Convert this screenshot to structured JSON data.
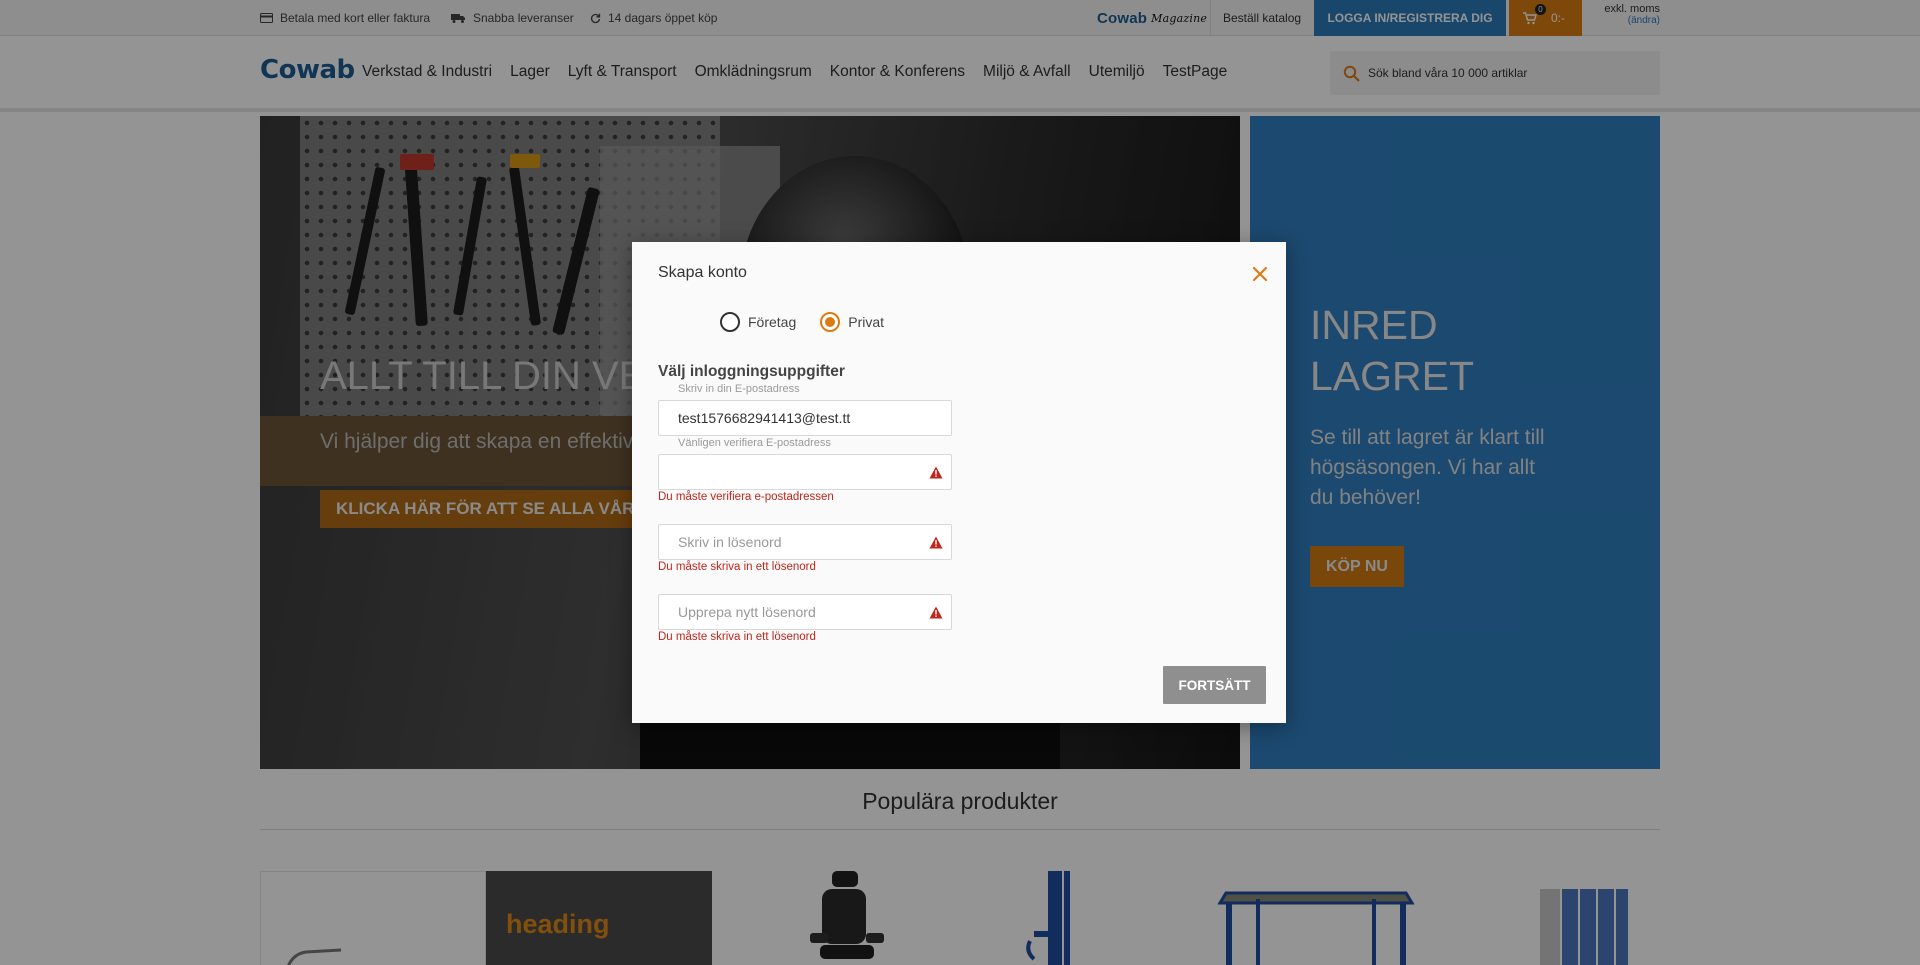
{
  "topbar": {
    "usps": [
      "Betala med kort eller faktura",
      "Snabba leveranser",
      "14 dagars öppet köp"
    ],
    "magazine_brand": "Cowab",
    "magazine_word": "Magazine",
    "catalog_link": "Beställ katalog",
    "login_button": "LOGGA IN/REGISTRERA DIG",
    "cart_count": "0",
    "cart_total": "0:-",
    "vat_label": "exkl. moms",
    "vat_change": "(ändra)"
  },
  "nav": {
    "logo": "Cowab",
    "items": [
      "Verkstad & Industri",
      "Lager",
      "Lyft & Transport",
      "Omklädningsrum",
      "Kontor & Konferens",
      "Miljö & Avfall",
      "Utemiljö",
      "TestPage"
    ],
    "search_placeholder": "Sök bland våra 10 000 artiklar"
  },
  "hero": {
    "title": "ALLT TILL DIN VERKSTAD",
    "subtitle": "Vi hjälper dig att skapa en effektiv arbetsplats",
    "button": "KLICKA HÄR FÖR ATT SE ALLA VÅRA PRODUKTER"
  },
  "side_banner": {
    "title_line1": "INRED",
    "title_line2": "LAGRET",
    "text": "Se till att lagret är klart till högsäsongen. Vi har allt du behöver!",
    "button": "KÖP NU"
  },
  "popular": {
    "title": "Populära produkter",
    "promo_heading": "heading"
  },
  "modal": {
    "title": "Skapa konto",
    "account_types": [
      {
        "label": "Företag",
        "checked": false
      },
      {
        "label": "Privat",
        "checked": true
      }
    ],
    "section_title": "Välj inloggningsuppgifter",
    "email_label": "Skriv in din E-postadress",
    "email_value": "test1576682941413@test.tt",
    "verify_label": "Vänligen verifiera E-postadress",
    "verify_value": "",
    "verify_error": "Du måste verifiera e-postadressen",
    "password_placeholder": "Skriv in lösenord",
    "password_error": "Du måste skriva in ett lösenord",
    "repeat_placeholder": "Upprepa nytt lösenord",
    "repeat_error": "Du måste skriva in ett lösenord",
    "submit": "FORTSÄTT"
  },
  "colors": {
    "brand_blue": "#2b79b8",
    "accent_orange": "#d97d12",
    "error_red": "#c0261c"
  }
}
